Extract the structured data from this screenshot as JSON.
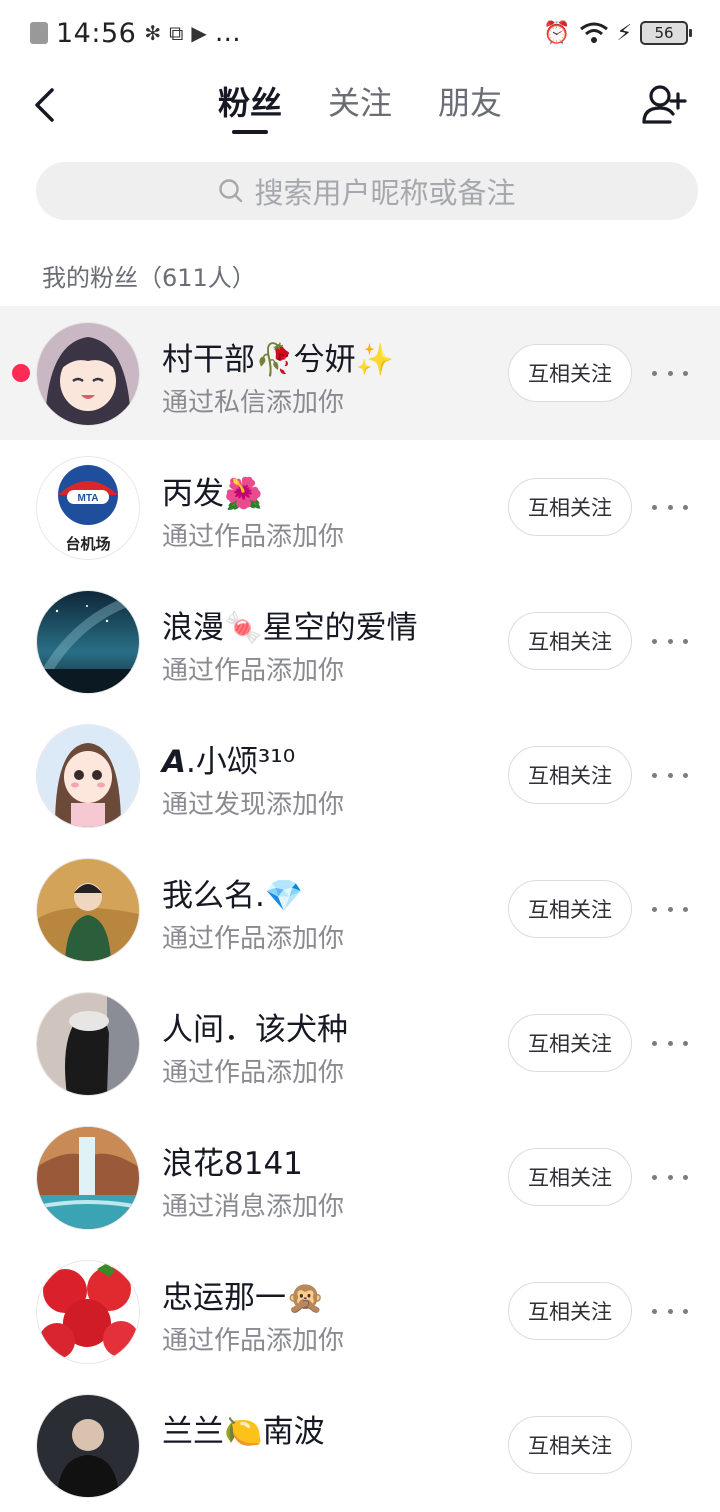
{
  "status_bar": {
    "time": "14:56",
    "extra_icons": "…",
    "battery": "56"
  },
  "header": {
    "tabs": [
      {
        "label": "粉丝",
        "active": true
      },
      {
        "label": "关注",
        "active": false
      },
      {
        "label": "朋友",
        "active": false
      }
    ],
    "back_icon": "chevron-left-icon",
    "add_friend_icon": "add-user-icon"
  },
  "search": {
    "placeholder": "搜索用户昵称或备注",
    "icon": "search-icon"
  },
  "section": {
    "title": "我的粉丝（611人）"
  },
  "fans": [
    {
      "name": "村干部🥀兮妍✨",
      "source": "通过私信添加你",
      "button": "互相关注",
      "unread": true
    },
    {
      "name": "丙发🌺",
      "source": "通过作品添加你",
      "button": "互相关注"
    },
    {
      "name": "浪漫🍬星空的爱情",
      "source": "通过作品添加你",
      "button": "互相关注"
    },
    {
      "name": "𝘼.小颂³¹⁰",
      "source": "通过发现添加你",
      "button": "互相关注"
    },
    {
      "name": "我么名.💎",
      "source": "通过作品添加你",
      "button": "互相关注"
    },
    {
      "name": "人间．该犬种",
      "source": "通过作品添加你",
      "button": "互相关注"
    },
    {
      "name": "浪花8141",
      "source": "通过消息添加你",
      "button": "互相关注"
    },
    {
      "name": "忠运那一🙊",
      "source": "通过作品添加你",
      "button": "互相关注"
    },
    {
      "name": "兰兰🍋南波",
      "source": "",
      "button": "互相关注"
    }
  ],
  "colors": {
    "accent": "#fe2c55",
    "text_primary": "#161823",
    "text_secondary": "#8a8b91"
  }
}
